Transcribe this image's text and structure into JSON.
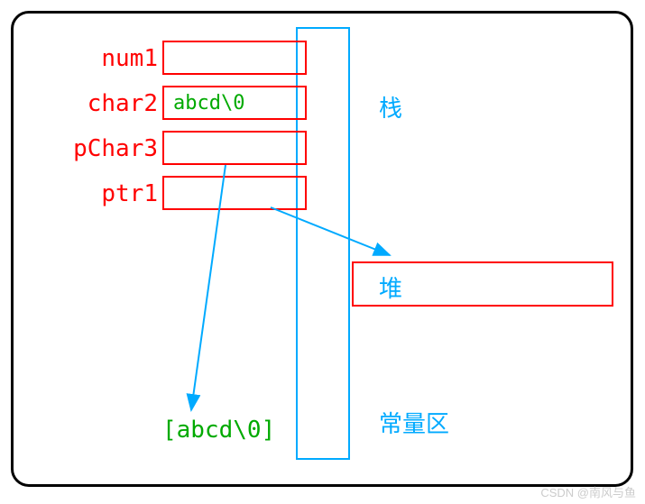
{
  "vars": {
    "num1": "num1",
    "char2": "char2",
    "pChar3": "pChar3",
    "ptr1": "ptr1",
    "char2_value": "abcd\\0",
    "constant_value": "[abcd\\0]"
  },
  "regions": {
    "stack": "栈",
    "heap": "堆",
    "constant": "常量区"
  },
  "watermark": "CSDN @南风与鱼"
}
